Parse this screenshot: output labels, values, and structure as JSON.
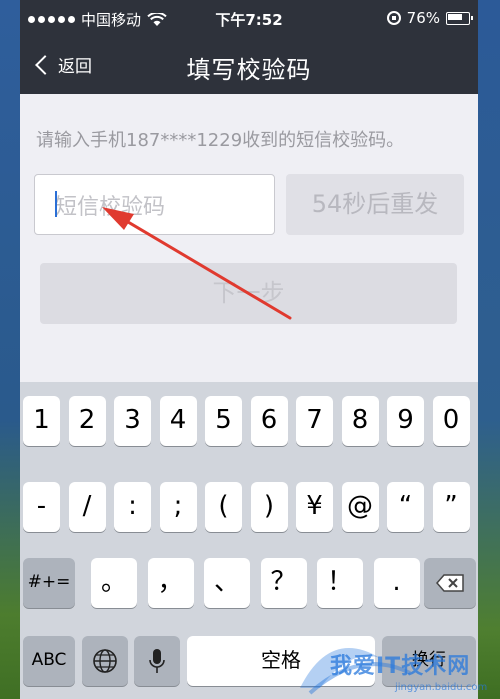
{
  "status_bar": {
    "carrier": "中国移动",
    "time": "下午7:52",
    "battery": "76%",
    "battery_level": 0.76
  },
  "navbar": {
    "back_label": "返回",
    "title": "填写校验码"
  },
  "form": {
    "prompt": "请输入手机187****1229收到的短信校验码。",
    "code_placeholder": "短信校验码",
    "resend_label": "54秒后重发",
    "next_label": "下一步"
  },
  "keyboard": {
    "row1": [
      "1",
      "2",
      "3",
      "4",
      "5",
      "6",
      "7",
      "8",
      "9",
      "0"
    ],
    "row2": [
      "-",
      "/",
      ":",
      ";",
      "(",
      ")",
      "¥",
      "@",
      "“",
      "”"
    ],
    "row3_left": "#+=",
    "row3": [
      "。",
      "，",
      "、",
      "？",
      "！",
      "."
    ],
    "row4": {
      "abc": "ABC",
      "space": "空格",
      "return": "换行"
    }
  },
  "watermark": {
    "text": "我爱IT技术网",
    "sub": "jingyan.baidu.com"
  },
  "colors": {
    "navbar_bg": "#2e323b",
    "page_bg": "#efeff4",
    "arrow": "#e03a2f",
    "keyboard_bg": "#d1d5dc"
  }
}
